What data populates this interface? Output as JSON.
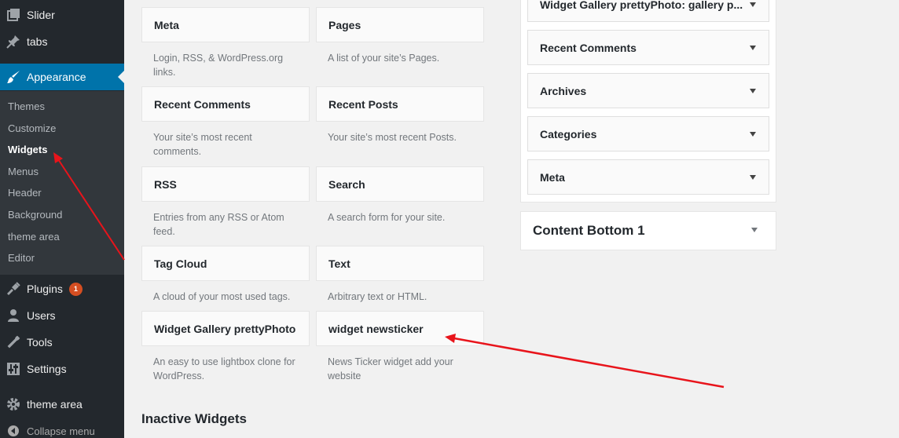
{
  "sidebar": {
    "menu": [
      {
        "label": "Slider",
        "icon": "gallery-icon"
      },
      {
        "label": "tabs",
        "icon": "pin-icon"
      },
      {
        "label": "Appearance",
        "icon": "paintbrush-icon"
      },
      {
        "label": "Plugins",
        "icon": "plugin-icon",
        "badge": "1"
      },
      {
        "label": "Users",
        "icon": "user-icon"
      },
      {
        "label": "Tools",
        "icon": "wrench-icon"
      },
      {
        "label": "Settings",
        "icon": "settings-icon"
      },
      {
        "label": "theme area",
        "icon": "gear-icon"
      }
    ],
    "submenu": [
      "Themes",
      "Customize",
      "Widgets",
      "Menus",
      "Header",
      "Background",
      "theme area",
      "Editor"
    ],
    "collapse_label": "Collapse menu"
  },
  "available_widgets": [
    {
      "title": "Meta",
      "desc": "Login, RSS, & WordPress.org links."
    },
    {
      "title": "Pages",
      "desc": "A list of your site’s Pages."
    },
    {
      "title": "Recent Comments",
      "desc": "Your site’s most recent comments."
    },
    {
      "title": "Recent Posts",
      "desc": "Your site’s most recent Posts."
    },
    {
      "title": "RSS",
      "desc": "Entries from any RSS or Atom feed."
    },
    {
      "title": "Search",
      "desc": "A search form for your site."
    },
    {
      "title": "Tag Cloud",
      "desc": "A cloud of your most used tags."
    },
    {
      "title": "Text",
      "desc": "Arbitrary text or HTML."
    },
    {
      "title": "Widget Gallery prettyPhoto",
      "desc": "An easy to use lightbox clone for WordPress."
    },
    {
      "title": "widget newsticker",
      "desc": "News Ticker widget add your website"
    }
  ],
  "inactive_title": "Inactive Widgets",
  "widget_area": {
    "widgets": [
      "Widget Gallery prettyPhoto: gallery p...",
      "Recent Comments",
      "Archives",
      "Categories",
      "Meta"
    ],
    "content_bottom": "Content Bottom 1"
  },
  "colors": {
    "accent": "#0073aa",
    "annotation": "#e8141b",
    "badge": "#d54e21"
  }
}
